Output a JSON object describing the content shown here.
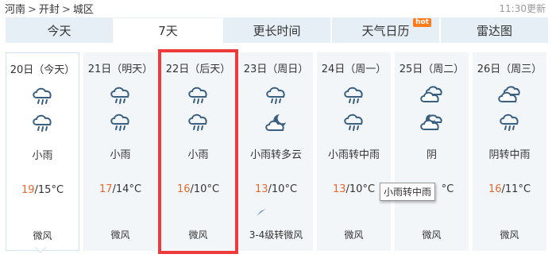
{
  "breadcrumb": [
    "河南",
    "开封",
    "城区"
  ],
  "breadcrumb_sep": ">",
  "update_time": "11:30更新",
  "tabs": [
    {
      "label": "今天",
      "active": false,
      "hot": false
    },
    {
      "label": "7天",
      "active": true,
      "hot": false
    },
    {
      "label": "更长时间",
      "active": false,
      "hot": false
    },
    {
      "label": "天气日历",
      "active": false,
      "hot": true
    },
    {
      "label": "雷达图",
      "active": false,
      "hot": false
    }
  ],
  "hot_badge": "hot",
  "days": [
    {
      "date": "20日（今天）",
      "icon1": "rain-cloud-icon",
      "icon2": "rain-cloud-icon",
      "weather": "小雨",
      "high": "19",
      "low": "/15°C",
      "wind": "微风"
    },
    {
      "date": "21日（明天）",
      "icon1": "rain-cloud-icon",
      "icon2": "rain-cloud-icon",
      "weather": "小雨",
      "high": "17",
      "low": "/14°C",
      "wind": "微风"
    },
    {
      "date": "22日（后天）",
      "icon1": "rain-cloud-icon",
      "icon2": "rain-cloud-icon",
      "weather": "小雨",
      "high": "16",
      "low": "/10°C",
      "wind": "微风"
    },
    {
      "date": "23日（周日）",
      "icon1": "rain-cloud-icon",
      "icon2": "cloudy-night-icon",
      "weather": "小雨转多云",
      "high": "13",
      "low": "/10°C",
      "wind": "3-4级转微风"
    },
    {
      "date": "24日（周一）",
      "icon1": "rain-cloud-icon",
      "icon2": "rain-cloud-icon",
      "weather": "小雨转中雨",
      "high": "13",
      "low": "/10°C",
      "wind": "微风"
    },
    {
      "date": "25日（周二）",
      "icon1": "overcast-icon",
      "icon2": "overcast-night-icon",
      "weather": "阴",
      "high": "",
      "low": "°C",
      "wind": "微风"
    },
    {
      "date": "26日（周三）",
      "icon1": "overcast-icon",
      "icon2": "rain-cloud-icon",
      "weather": "阴转中雨",
      "high": "16",
      "low": "/11°C",
      "wind": "微风"
    }
  ],
  "tooltip": "小雨转中雨",
  "colors": {
    "accent_red": "#ee3a3a",
    "high_temp": "#e8692e",
    "tab_bg": "#e6eff6",
    "icon": "#3a5f80"
  }
}
